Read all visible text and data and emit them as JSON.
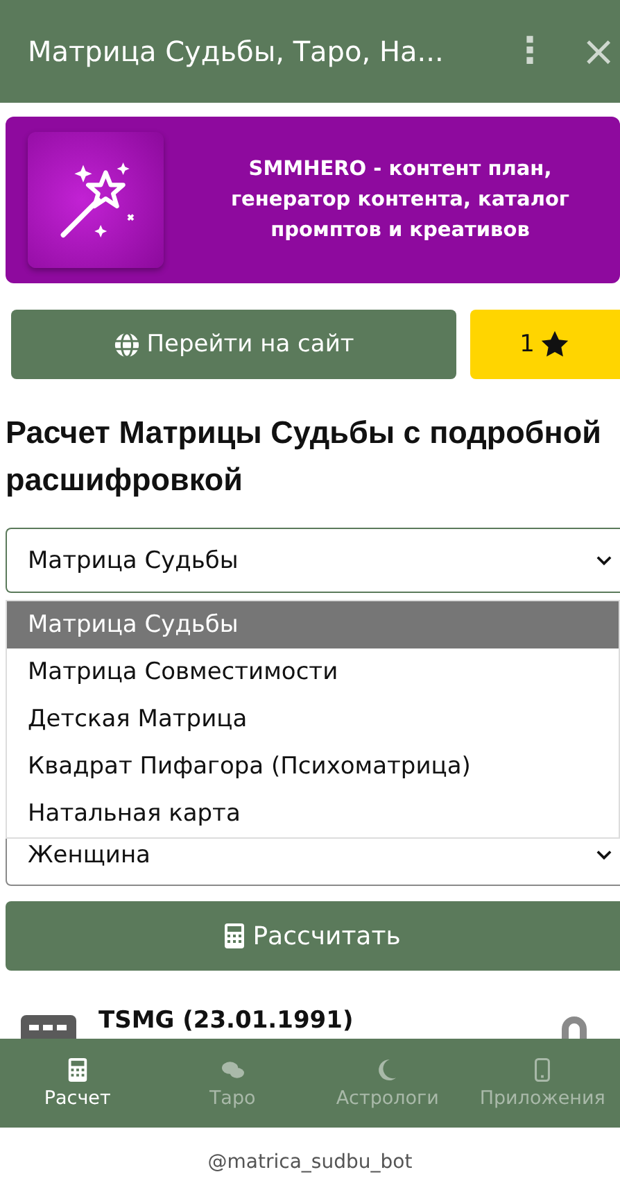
{
  "header": {
    "title": "Матрица Судьбы, Таро, На...",
    "menu_glyph": "⋮",
    "close_glyph": "×"
  },
  "banner": {
    "text": "SMMHERO - контент план, генератор контента, каталог промптов и креативов"
  },
  "actions": {
    "site_button": "Перейти на сайт",
    "rating_button": "1"
  },
  "heading": "Расчет Матрицы Судьбы с подробной расшифровкой",
  "calc_type": {
    "value": "Матрица Судьбы",
    "options": [
      {
        "label": "Матрица Судьбы",
        "selected": true
      },
      {
        "label": "Матрица Совместимости",
        "selected": false
      },
      {
        "label": "Детская Матрица",
        "selected": false
      },
      {
        "label": "Квадрат Пифагора (Психоматрица)",
        "selected": false
      },
      {
        "label": "Натальная карта",
        "selected": false
      }
    ]
  },
  "gender": {
    "value": "Женщина"
  },
  "calculate_button": "Рассчитать",
  "saved": [
    {
      "title": "TSMG (23.01.1991)"
    }
  ],
  "bottom_nav": [
    {
      "label": "Расчет",
      "selected": true
    },
    {
      "label": "Таро",
      "selected": false
    },
    {
      "label": "Астрологи",
      "selected": false
    },
    {
      "label": "Приложения",
      "selected": false
    }
  ],
  "footer": "@matrica_sudbu_bot"
}
